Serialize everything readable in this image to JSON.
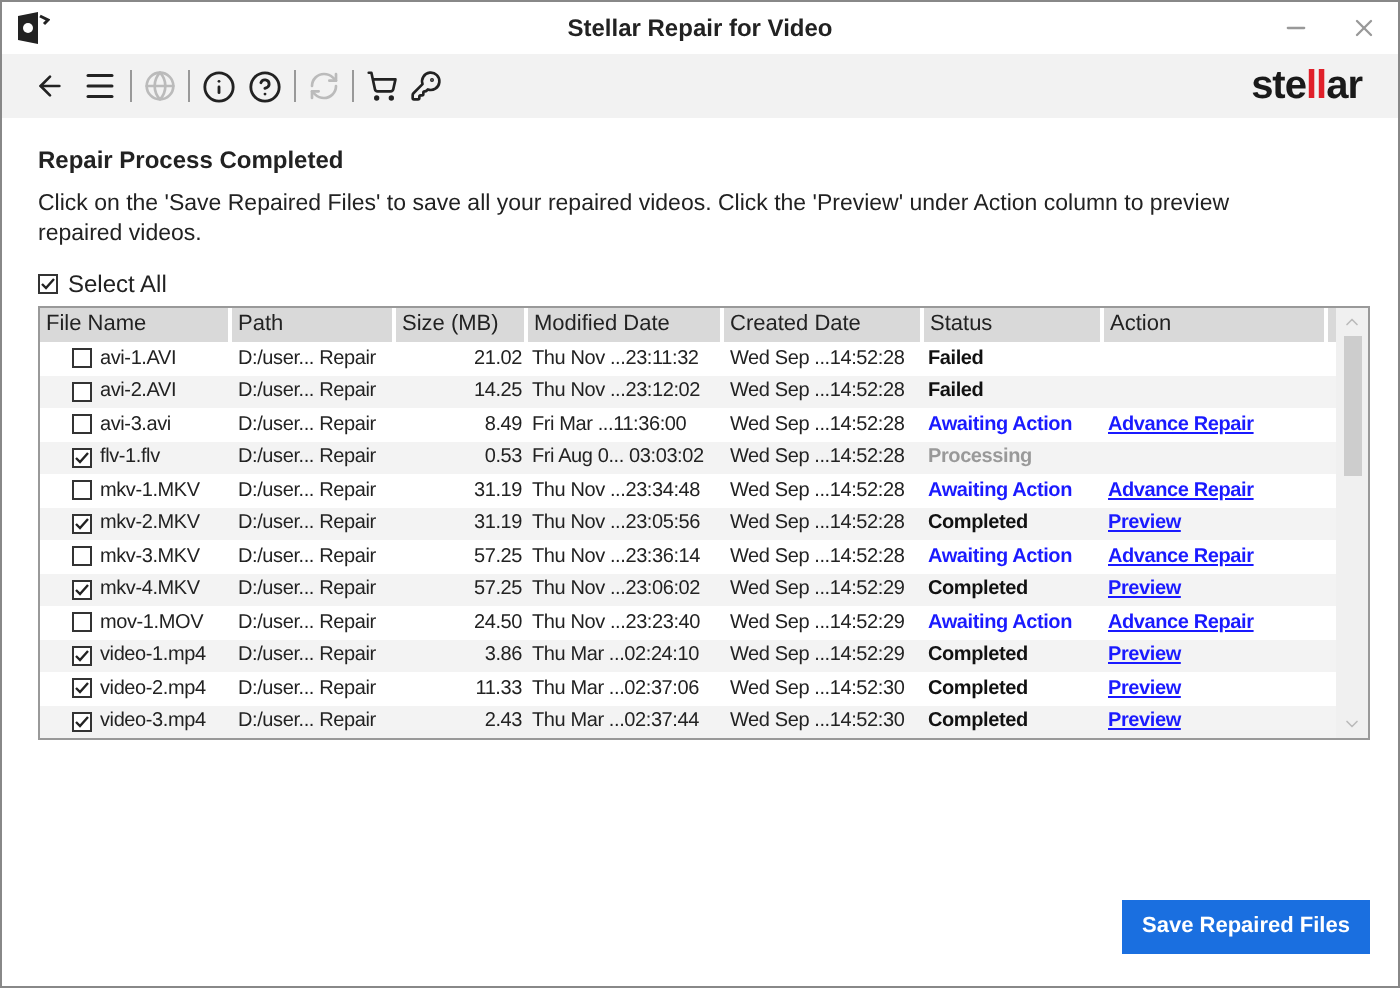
{
  "window": {
    "title": "Stellar Repair for Video"
  },
  "logo": {
    "parts": [
      {
        "text": "ste",
        "color": "#1a1a1a"
      },
      {
        "text": "ll",
        "color": "#e0202a"
      },
      {
        "text": "ar",
        "color": "#1a1a1a"
      }
    ]
  },
  "heading": "Repair Process Completed",
  "instructions": "Click on the 'Save Repaired Files' to save all your repaired videos. Click the 'Preview' under Action column to preview repaired videos.",
  "select_all": {
    "label": "Select All",
    "checked": true
  },
  "table": {
    "columns": [
      "File Name",
      "Path",
      "Size (MB)",
      "Modified Date",
      "Created Date",
      "Status",
      "Action"
    ],
    "rows": [
      {
        "checked": false,
        "name": "avi-1.AVI",
        "path": "D:/user... Repair",
        "size": "21.02",
        "modified": "Thu Nov ...23:11:32",
        "created": "Wed Sep ...14:52:28",
        "status": "Failed",
        "kind": "failed"
      },
      {
        "checked": false,
        "name": "avi-2.AVI",
        "path": "D:/user... Repair",
        "size": "14.25",
        "modified": "Thu Nov ...23:12:02",
        "created": "Wed Sep ...14:52:28",
        "status": "Failed",
        "kind": "failed"
      },
      {
        "checked": false,
        "name": "avi-3.avi",
        "path": "D:/user... Repair",
        "size": "8.49",
        "modified": "Fri Mar ...11:36:00",
        "created": "Wed Sep ...14:52:28",
        "status": "Awaiting Action",
        "kind": "awaiting",
        "action": "Advance Repair"
      },
      {
        "checked": true,
        "name": "flv-1.flv",
        "path": "D:/user... Repair",
        "size": "0.53",
        "modified": "Fri Aug 0... 03:03:02",
        "created": "Wed Sep ...14:52:28",
        "status": "Processing",
        "kind": "processing"
      },
      {
        "checked": false,
        "name": "mkv-1.MKV",
        "path": "D:/user... Repair",
        "size": "31.19",
        "modified": "Thu Nov ...23:34:48",
        "created": "Wed Sep ...14:52:28",
        "status": "Awaiting Action",
        "kind": "awaiting",
        "action": "Advance Repair"
      },
      {
        "checked": true,
        "name": "mkv-2.MKV",
        "path": "D:/user... Repair",
        "size": "31.19",
        "modified": "Thu Nov ...23:05:56",
        "created": "Wed Sep ...14:52:28",
        "status": "Completed",
        "kind": "completed",
        "action": "Preview"
      },
      {
        "checked": false,
        "name": "mkv-3.MKV",
        "path": "D:/user... Repair",
        "size": "57.25",
        "modified": "Thu Nov ...23:36:14",
        "created": "Wed Sep ...14:52:28",
        "status": "Awaiting Action",
        "kind": "awaiting",
        "action": "Advance Repair"
      },
      {
        "checked": true,
        "name": "mkv-4.MKV",
        "path": "D:/user... Repair",
        "size": "57.25",
        "modified": "Thu Nov ...23:06:02",
        "created": "Wed Sep ...14:52:29",
        "status": "Completed",
        "kind": "completed",
        "action": "Preview"
      },
      {
        "checked": false,
        "name": "mov-1.MOV",
        "path": "D:/user... Repair",
        "size": "24.50",
        "modified": "Thu Nov ...23:23:40",
        "created": "Wed Sep ...14:52:29",
        "status": "Awaiting Action",
        "kind": "awaiting",
        "action": "Advance Repair"
      },
      {
        "checked": true,
        "name": "video-1.mp4",
        "path": "D:/user... Repair",
        "size": "3.86",
        "modified": "Thu Mar ...02:24:10",
        "created": "Wed Sep ...14:52:29",
        "status": "Completed",
        "kind": "completed",
        "action": "Preview"
      },
      {
        "checked": true,
        "name": "video-2.mp4",
        "path": "D:/user... Repair",
        "size": "11.33",
        "modified": "Thu Mar ...02:37:06",
        "created": "Wed Sep ...14:52:30",
        "status": "Completed",
        "kind": "completed",
        "action": "Preview"
      },
      {
        "checked": true,
        "name": "video-3.mp4",
        "path": "D:/user... Repair",
        "size": "2.43",
        "modified": "Thu Mar ...02:37:44",
        "created": "Wed Sep ...14:52:30",
        "status": "Completed",
        "kind": "completed",
        "action": "Preview"
      }
    ]
  },
  "save_button": "Save Repaired Files"
}
